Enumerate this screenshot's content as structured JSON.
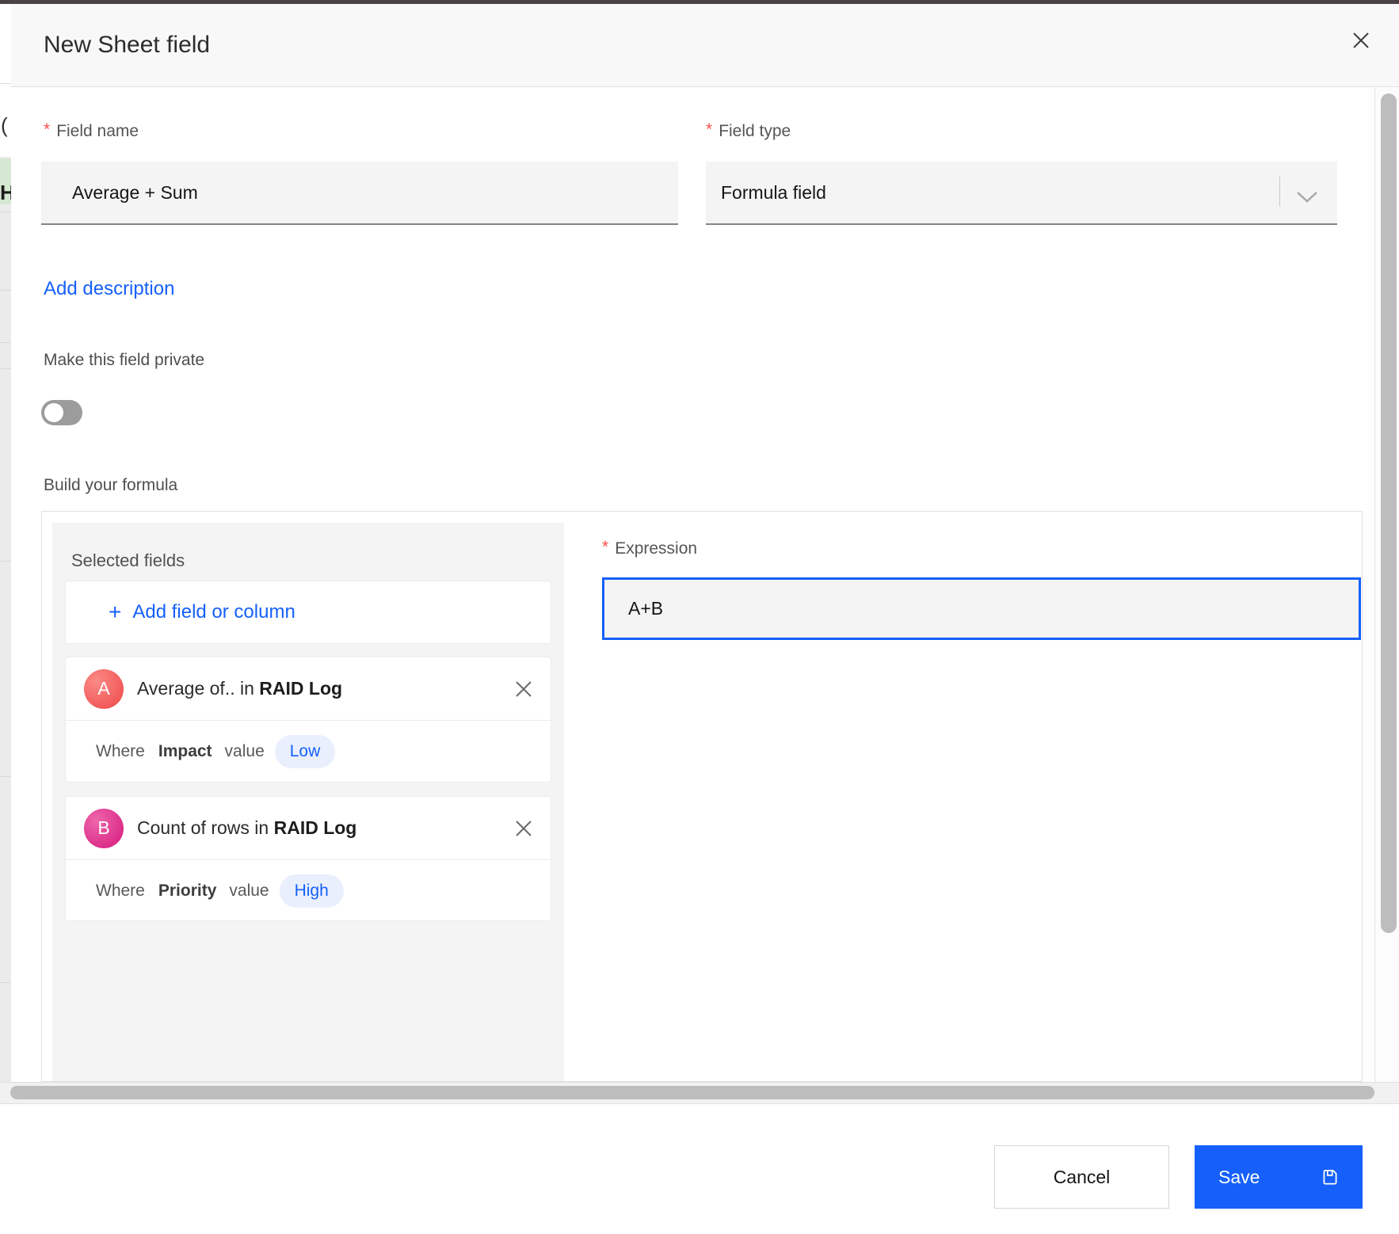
{
  "dialog": {
    "title": "New Sheet field",
    "required_marker": "*"
  },
  "underlay": {
    "partial_text_paren": "(",
    "partial_text_h": "H"
  },
  "fields": {
    "field_name": {
      "label": "Field name",
      "required": true,
      "value": "Average + Sum"
    },
    "field_type": {
      "label": "Field type",
      "required": true,
      "value": "Formula field"
    }
  },
  "actions": {
    "add_description_label": "Add description"
  },
  "privacy": {
    "label": "Make this field private",
    "toggle_on": false
  },
  "formula": {
    "section_label": "Build your formula",
    "selected_fields_label": "Selected fields",
    "add_field_plus": "+",
    "add_field_label": "Add field or column",
    "fields": [
      {
        "id": "A",
        "title_prefix": "Average of.. in",
        "source": "RAID Log",
        "where": {
          "label": "Where",
          "column": "Impact",
          "value_label": "value",
          "value": "Low"
        }
      },
      {
        "id": "B",
        "title_prefix": "Count of rows in",
        "source": "RAID Log",
        "where": {
          "label": "Where",
          "column": "Priority",
          "value_label": "value",
          "value": "High"
        }
      }
    ],
    "expression": {
      "label": "Expression",
      "required": true,
      "value": "A+B"
    }
  },
  "footer": {
    "cancel_label": "Cancel",
    "save_label": "Save"
  },
  "icons": {
    "close": "x-cross",
    "chevron_down": "v-chevron",
    "save": "floppy-disk",
    "plus": "+"
  },
  "colors": {
    "accent_blue": "#1560fa",
    "pill_bg": "#e9effd",
    "avatar_a": "#ee4747",
    "avatar_b": "#d6187d",
    "required_red": "#fa4d4d",
    "top_strip": "#4a4247",
    "input_bg": "#f4f4f4"
  }
}
